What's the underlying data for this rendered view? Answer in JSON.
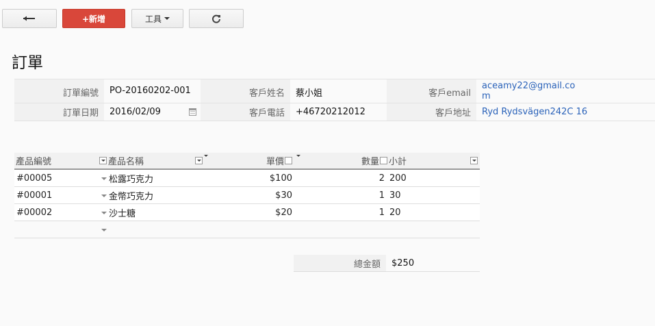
{
  "toolbar": {
    "back_icon": "arrow-left-icon",
    "new_label": "+新增",
    "tools_label": "工具",
    "refresh_icon": "refresh-icon"
  },
  "page_title": "訂單",
  "order": {
    "number_label": "訂單編號",
    "number": "PO-20160202-001",
    "date_label": "訂單日期",
    "date": "2016/02/09",
    "customer_name_label": "客戶姓名",
    "customer_name": "蔡小姐",
    "customer_phone_label": "客戶電話",
    "customer_phone": "+46720212012",
    "customer_email_label": "客戶email",
    "customer_email_line1": "aceamy22@gmail.co",
    "customer_email_line2": "m",
    "customer_address_label": "客戶地址",
    "customer_address": "Ryd Rydsvägen242C 16"
  },
  "table": {
    "headers": [
      "產品編號",
      "產品名稱",
      "單價",
      "數量",
      "小計"
    ],
    "rows": [
      {
        "code": "#00005",
        "name": "松露巧克力",
        "price": "$100",
        "qty": "2",
        "subtotal": "200"
      },
      {
        "code": "#00001",
        "name": "金幣巧克力",
        "price": "$30",
        "qty": "1",
        "subtotal": "30"
      },
      {
        "code": "#00002",
        "name": "沙士糖",
        "price": "$20",
        "qty": "1",
        "subtotal": "20"
      }
    ]
  },
  "total": {
    "label": "總金額",
    "value": "$250"
  },
  "colors": {
    "accent_red": "#d9473a",
    "link_blue": "#2a62b9"
  }
}
